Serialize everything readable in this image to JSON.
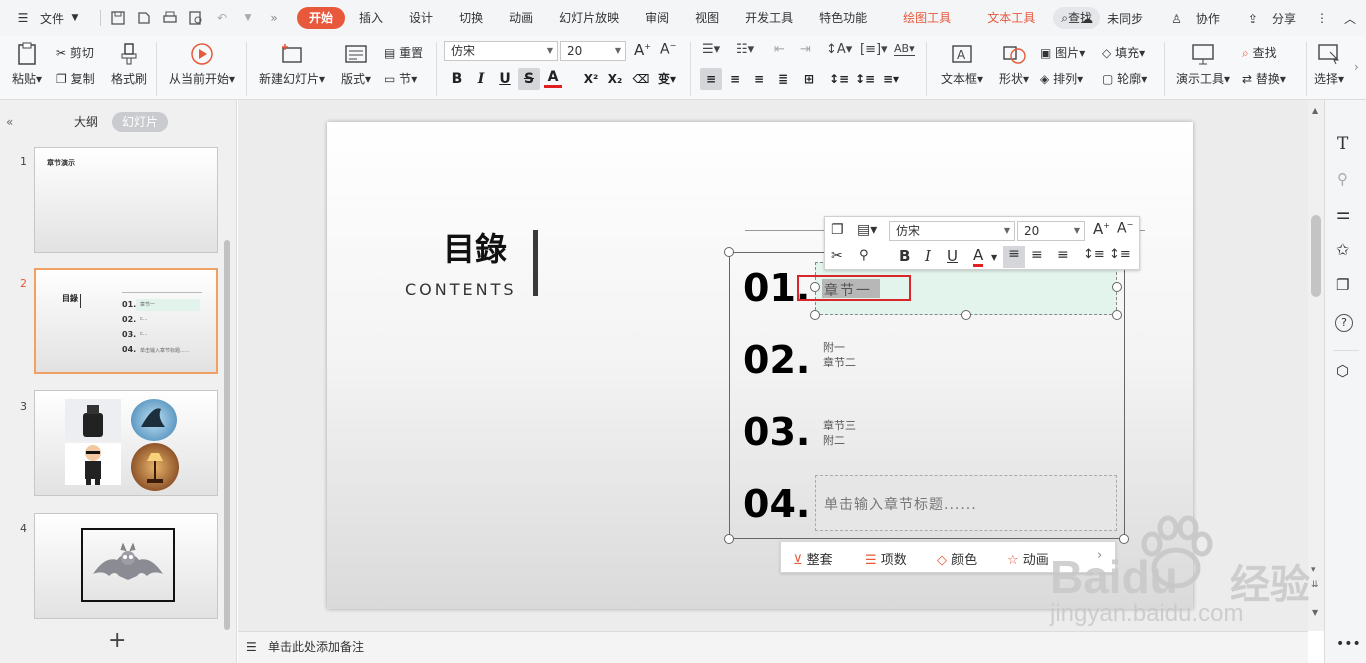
{
  "quickbar": {
    "menu": "文件"
  },
  "tabs": [
    {
      "label": "开始",
      "active": true
    },
    {
      "label": "插入"
    },
    {
      "label": "设计"
    },
    {
      "label": "切换"
    },
    {
      "label": "动画"
    },
    {
      "label": "幻灯片放映"
    },
    {
      "label": "审阅"
    },
    {
      "label": "视图"
    },
    {
      "label": "开发工具"
    },
    {
      "label": "特色功能"
    },
    {
      "label": "绘图工具",
      "accent": true
    },
    {
      "label": "文本工具",
      "accent": true
    }
  ],
  "search_label": "查找",
  "top_right": {
    "sync": "未同步",
    "collab": "协作",
    "share": "分享"
  },
  "ribbon": {
    "paste": "粘贴",
    "cut": "剪切",
    "copy": "复制",
    "format_painter": "格式刷",
    "play_from_current": "从当前开始",
    "new_slide": "新建幻灯片",
    "layout": "版式",
    "reset": "重置",
    "section": "节",
    "font_name": "仿宋",
    "font_size": "20",
    "textbox": "文本框",
    "shape": "形状",
    "picture": "图片",
    "fill": "填充",
    "arrange": "排列",
    "outline": "轮廓",
    "present_tools": "演示工具",
    "find": "查找",
    "replace": "替换",
    "select": "选择"
  },
  "panel": {
    "tab_outline": "大纲",
    "tab_slides": "幻灯片",
    "add": "+"
  },
  "thumbs": [
    {
      "num": "1",
      "title": "章节演示"
    },
    {
      "num": "2"
    },
    {
      "num": "3"
    },
    {
      "num": "4"
    }
  ],
  "thumb2": {
    "title": "目錄",
    "items": [
      {
        "num": "01.",
        "text": "章节一"
      },
      {
        "num": "02.",
        "text": "c..."
      },
      {
        "num": "03.",
        "text": "c..."
      },
      {
        "num": "04.",
        "text": "单击输入章节标题......"
      }
    ]
  },
  "slide": {
    "title": "目錄",
    "subtitle": "CONTENTS",
    "items": [
      {
        "num": "01.",
        "lines": [
          "章节一"
        ]
      },
      {
        "num": "02.",
        "lines": [
          "附一",
          "章节二"
        ]
      },
      {
        "num": "03.",
        "lines": [
          "章节三",
          "附二"
        ]
      },
      {
        "num": "04.",
        "placeholder": "单击输入章节标题......"
      }
    ]
  },
  "floatbar": {
    "font": "仿宋",
    "size": "20"
  },
  "quick_actions": [
    {
      "label": "整套"
    },
    {
      "label": "项数"
    },
    {
      "label": "颜色"
    },
    {
      "label": "动画"
    }
  ],
  "notes_placeholder": "单击此处添加备注",
  "watermark": {
    "brand": "Baidu",
    "cn": "经验",
    "url": "jingyan.baidu.com"
  }
}
